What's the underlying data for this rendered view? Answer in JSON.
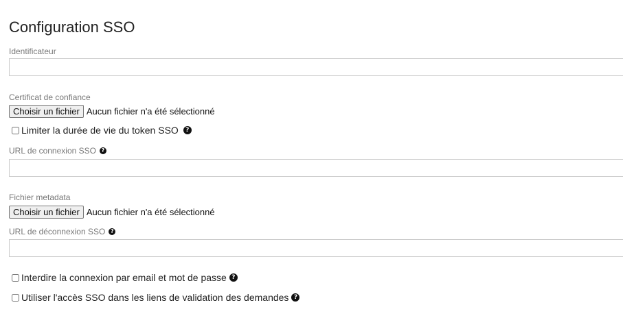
{
  "page_title": "Configuration SSO",
  "identifier": {
    "label": "Identificateur",
    "value": ""
  },
  "certificate": {
    "label": "Certificat de confiance",
    "button_label": "Choisir un fichier",
    "status": "Aucun fichier n'a été sélectionné"
  },
  "limit_token": {
    "label": "Limiter la durée de vie du token SSO",
    "checked": false,
    "help_icon": "question-circle-icon"
  },
  "login_url": {
    "label": "URL de connexion SSO",
    "value": "",
    "help_icon": "question-circle-icon"
  },
  "metadata": {
    "label": "Fichier metadata",
    "button_label": "Choisir un fichier",
    "status": "Aucun fichier n'a été sélectionné"
  },
  "logout_url": {
    "label": "URL de déconnexion SSO",
    "value": "",
    "help_icon": "question-circle-icon"
  },
  "forbid_email_login": {
    "label": "Interdire la connexion par email et mot de passe",
    "checked": false,
    "help_icon": "question-circle-icon"
  },
  "sso_validation_links": {
    "label": "Utiliser l'accès SSO dans les liens de validation des demandes",
    "checked": false,
    "help_icon": "question-circle-icon"
  },
  "help_icon_glyph": "?"
}
